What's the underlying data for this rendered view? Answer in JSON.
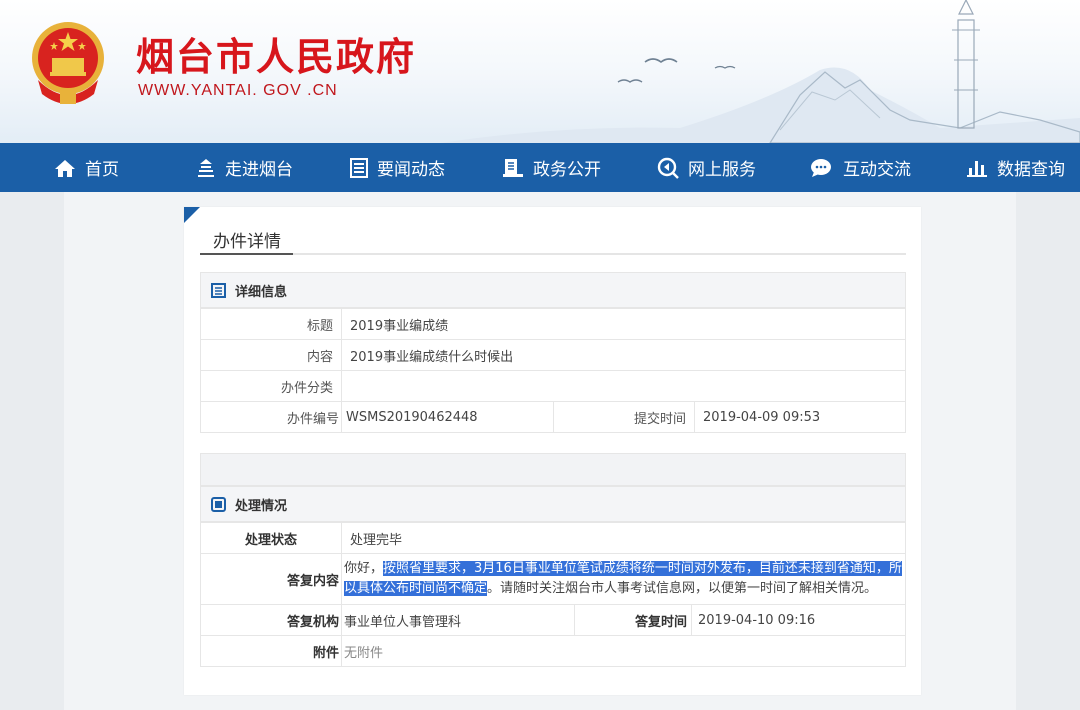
{
  "header": {
    "title": "烟台市人民政府",
    "url": "WWW.YANTAI. GOV .CN"
  },
  "nav": {
    "items": [
      {
        "label": "首页",
        "icon": "home-icon"
      },
      {
        "label": "走进烟台",
        "icon": "building-icon"
      },
      {
        "label": "要闻动态",
        "icon": "document-icon"
      },
      {
        "label": "政务公开",
        "icon": "open-doc-icon"
      },
      {
        "label": "网上服务",
        "icon": "search-globe-icon"
      },
      {
        "label": "互动交流",
        "icon": "chat-icon"
      },
      {
        "label": "数据查询",
        "icon": "bar-chart-icon"
      }
    ]
  },
  "card": {
    "title": "办件详情",
    "detail": {
      "heading": "详细信息",
      "rows": {
        "title_label": "标题",
        "title_value": "2019事业编成绩",
        "content_label": "内容",
        "content_value": "2019事业编成绩什么时候出",
        "category_label": "办件分类",
        "category_value": "",
        "number_label": "办件编号",
        "number_value": "WSMS20190462448",
        "submit_label": "提交时间",
        "submit_value": "2019-04-09 09:53"
      }
    },
    "process": {
      "heading": "处理情况",
      "status_label": "处理状态",
      "status_value": "处理完毕",
      "reply_label": "答复内容",
      "reply_pre": "你好，",
      "reply_hl1": "按照省里要求，3月16日事业单位笔试成绩将统一时间对外发布，目前还未接到省通知，所以",
      "reply_hl2": "具体公布时间尚不确定",
      "reply_post": "。请随时关注烟台市人事考试信息网，以便第一时间了解相关情况。",
      "org_label": "答复机构",
      "org_value": "事业单位人事管理科",
      "time_label": "答复时间",
      "time_value": "2019-04-10 09:16",
      "attach_label": "附件",
      "attach_value": "无附件"
    }
  },
  "colors": {
    "brand_red": "#d7161c",
    "nav_blue": "#1b5fa7",
    "highlight": "#3470d9"
  }
}
